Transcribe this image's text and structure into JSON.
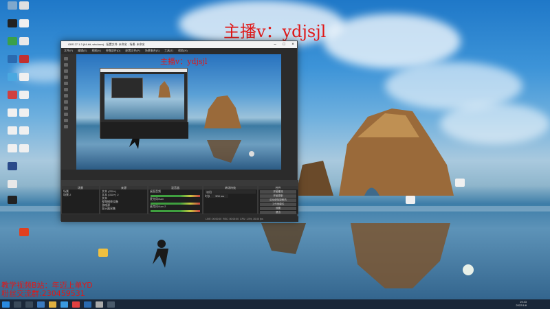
{
  "overlay_title": "主播v：ydjsjl",
  "nested_overlay_title": "主播v：ydjsjl",
  "promo": {
    "line1": "教学视频B站：年迈上单YD",
    "line2": "粉丝交流群:230459531"
  },
  "obs": {
    "title": "OBS 27.1.3 (64-bit, windows) - 配置文件: 未命名 - 场景: 未命名",
    "menu": [
      "文件(F)",
      "编辑(E)",
      "视图(V)",
      "停靠部件(D)",
      "配置文件(P)",
      "场景集合(S)",
      "工具(T)",
      "帮助(H)"
    ],
    "scenes_header": "场景",
    "scenes": [
      "场景",
      "场景 2"
    ],
    "sources_header": "来源",
    "sources": [
      "文本 (GDI+)",
      "文本 (GDI+) 2",
      "文本",
      "视频捕获设备",
      "游戏源",
      "显示器采集"
    ],
    "mixer_header": "混音器",
    "mixer_tracks": [
      "桌面音频",
      "麦克风/Aux",
      "麦克风/Aux 2"
    ],
    "transitions_header": "转场特效",
    "transition_name": "淡出",
    "duration_label": "时长",
    "duration_value": "300 ms",
    "controls_header": "控件",
    "controls": [
      "开始推流",
      "开始录制",
      "启动虚拟摄像机",
      "工作室模式",
      "设置",
      "退出"
    ],
    "status": [
      "LIVE: 00:00:00",
      "REC: 00:00:00",
      "CPU: 1.5%, 30.00 fps"
    ]
  },
  "taskbar": {
    "time": "19:43",
    "date": "2022/1/8"
  },
  "colors": {
    "overlay_red": "#e01818",
    "obs_bg": "#2b2b2b"
  }
}
